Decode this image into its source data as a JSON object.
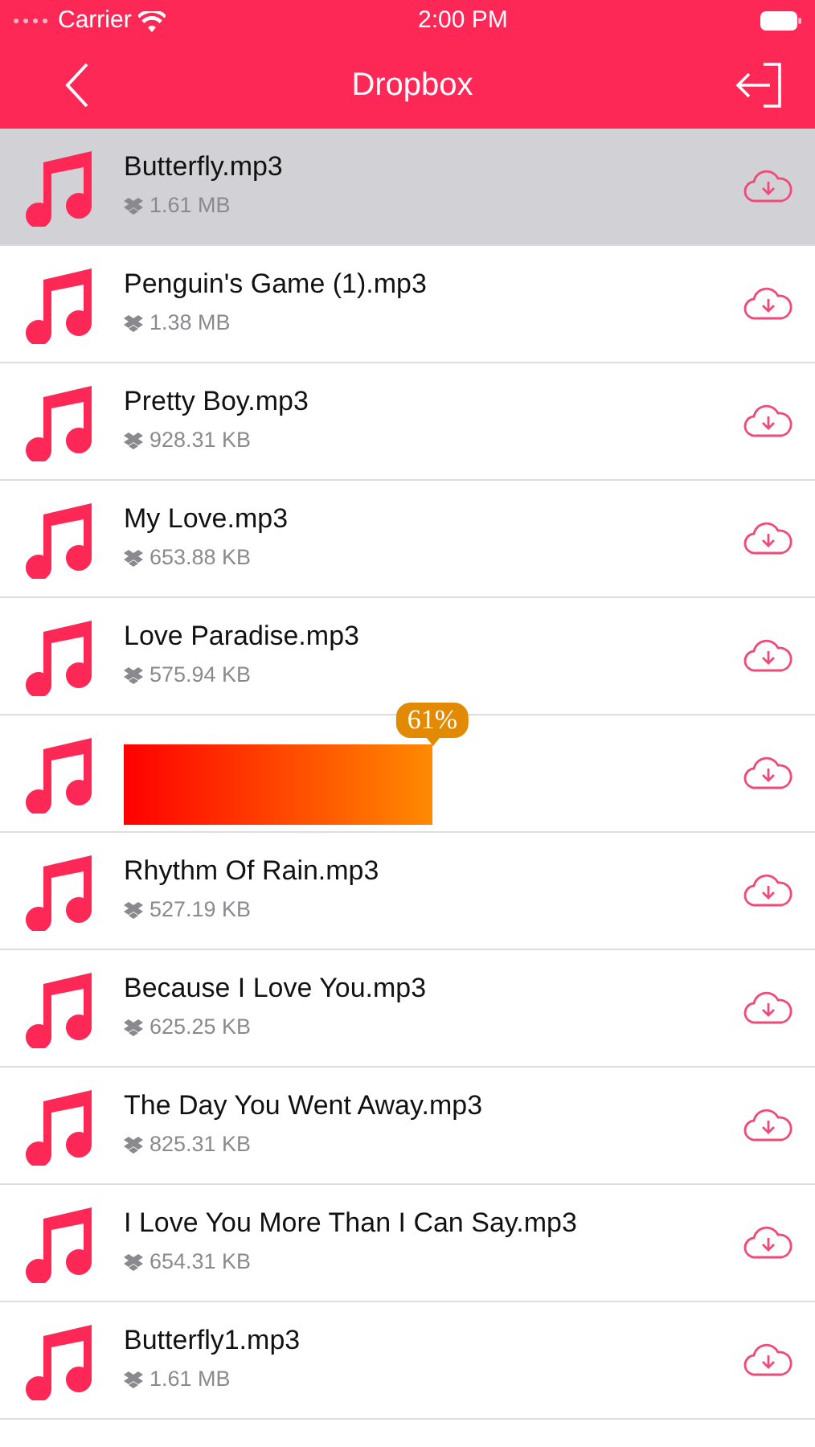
{
  "status_bar": {
    "carrier": "Carrier",
    "time": "2:00 PM"
  },
  "nav": {
    "title": "Dropbox"
  },
  "files": [
    {
      "kind": "file",
      "name": "Butterfly.mp3",
      "size": "1.61 MB",
      "selected": true
    },
    {
      "kind": "file",
      "name": "Penguin's Game (1).mp3",
      "size": "1.38 MB",
      "selected": false
    },
    {
      "kind": "file",
      "name": "Pretty Boy.mp3",
      "size": "928.31 KB",
      "selected": false
    },
    {
      "kind": "file",
      "name": "My Love.mp3",
      "size": "653.88 KB",
      "selected": false
    },
    {
      "kind": "file",
      "name": "Love Paradise.mp3",
      "size": "575.94 KB",
      "selected": false
    },
    {
      "kind": "progress",
      "label": "61%",
      "selected": false
    },
    {
      "kind": "file",
      "name": "Rhythm Of Rain.mp3",
      "size": "527.19 KB",
      "selected": false
    },
    {
      "kind": "file",
      "name": "Because I Love You.mp3",
      "size": "625.25 KB",
      "selected": false
    },
    {
      "kind": "file",
      "name": "The Day You Went Away.mp3",
      "size": "825.31 KB",
      "selected": false
    },
    {
      "kind": "file",
      "name": "I Love You More Than I Can Say.mp3",
      "size": "654.31 KB",
      "selected": false
    },
    {
      "kind": "file",
      "name": "Butterfly1.mp3",
      "size": "1.61 MB",
      "selected": false
    }
  ]
}
